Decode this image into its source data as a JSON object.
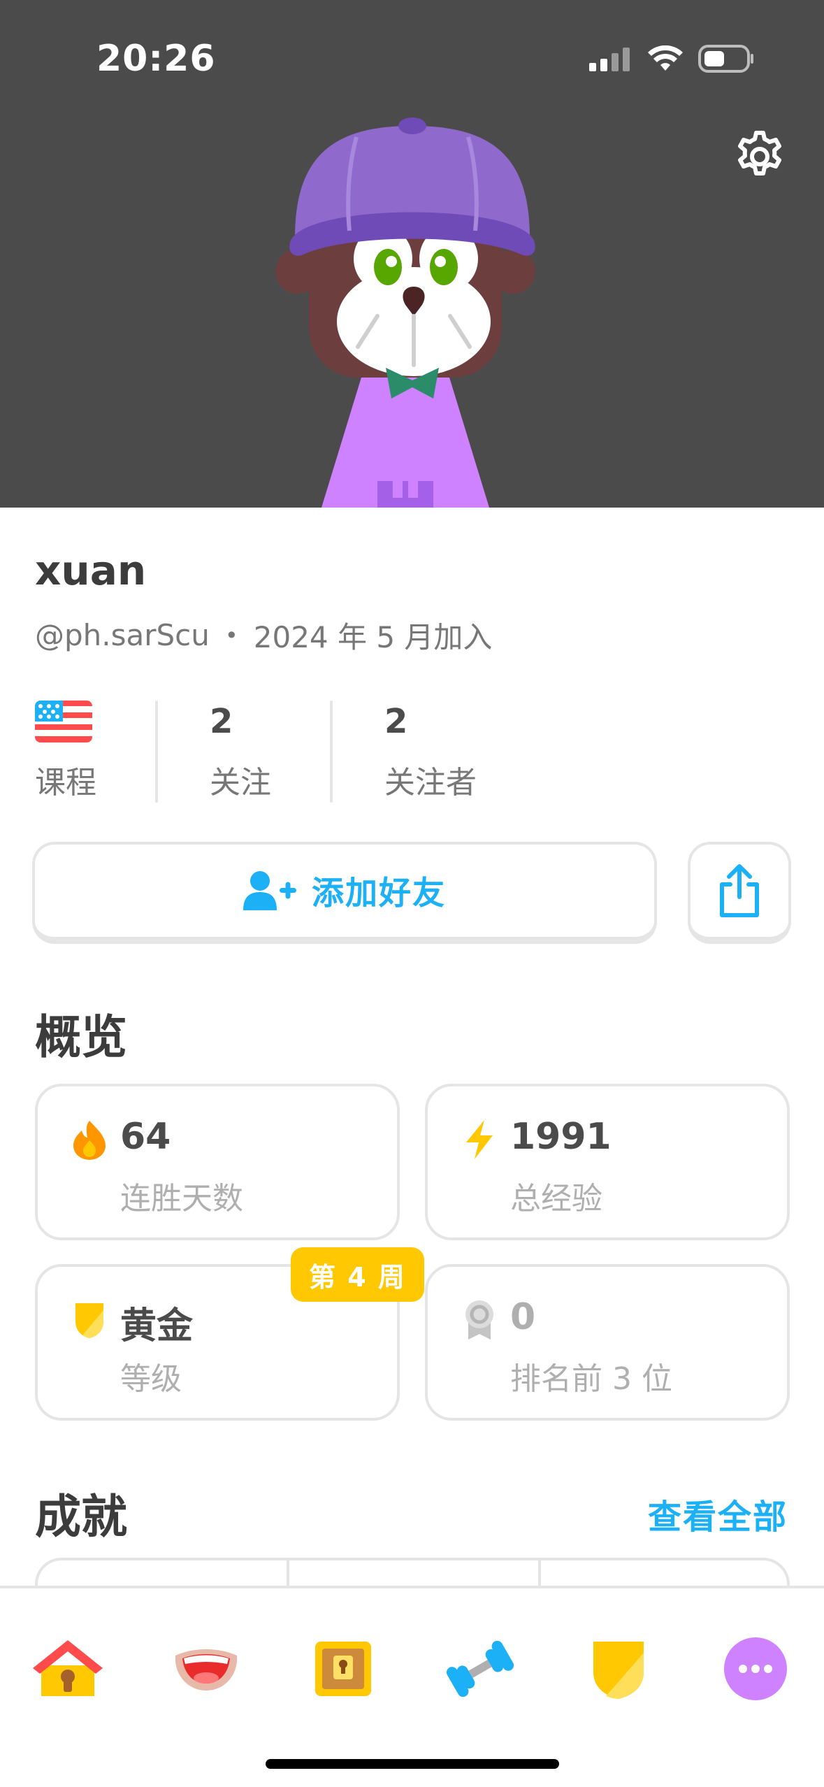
{
  "status_bar": {
    "time": "20:26"
  },
  "profile": {
    "name": "xuan",
    "handle": "@ph.sarScu",
    "joined": "2024 年 5 月加入",
    "stats": {
      "courses_label": "课程",
      "following_count": "2",
      "following_label": "关注",
      "followers_count": "2",
      "followers_label": "关注者"
    },
    "add_friend_label": "添加好友"
  },
  "overview": {
    "title": "概览",
    "cards": {
      "streak": {
        "value": "64",
        "label": "连胜天数"
      },
      "xp": {
        "value": "1991",
        "label": "总经验"
      },
      "league": {
        "value": "黄金",
        "label": "等级",
        "badge": "第 4 周"
      },
      "top3": {
        "value": "0",
        "label": "排名前 3 位"
      }
    }
  },
  "achievements": {
    "title": "成就",
    "see_all": "查看全部"
  },
  "colors": {
    "header_bg": "#4b4b4b",
    "accent_blue": "#1cb0f6",
    "gold": "#ffc800",
    "border": "#e5e5e5"
  },
  "tabs": [
    "home-icon",
    "speaking-icon",
    "treasure-chest-icon",
    "dumbbell-icon",
    "league-shield-icon",
    "more-icon"
  ]
}
